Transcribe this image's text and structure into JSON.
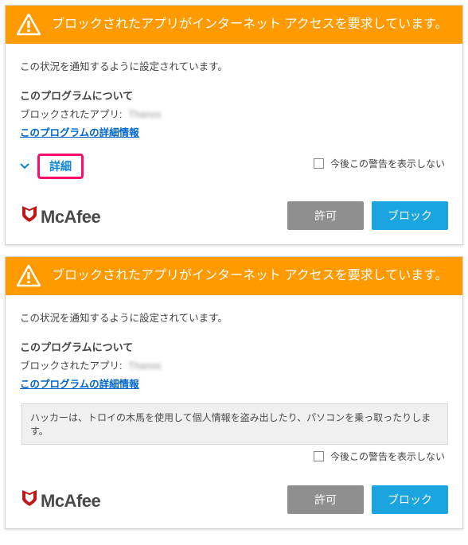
{
  "header": {
    "title": "ブロックされたアプリがインターネット アクセスを要求しています。"
  },
  "body": {
    "notice": "この状況を通知するように設定されています。",
    "about_title": "このプログラムについて",
    "blocked_app_label": "ブロックされたアプリ:",
    "blocked_app_name": "Thanos",
    "details_link": "このプログラムの詳細情報",
    "details_toggle": "詳細",
    "suppress_label": "今後この警告を表示しない",
    "info_strip": "ハッカーは、トロイの木馬を使用して個人情報を盗み出したり、パソコンを乗っ取ったりします。"
  },
  "footer": {
    "brand": "McAfee",
    "allow": "許可",
    "block": "ブロック"
  },
  "colors": {
    "accent_orange": "#ff9a00",
    "accent_blue": "#1aa5e0",
    "highlight_pink": "#ff0b6b",
    "brand_red": "#c01818"
  }
}
